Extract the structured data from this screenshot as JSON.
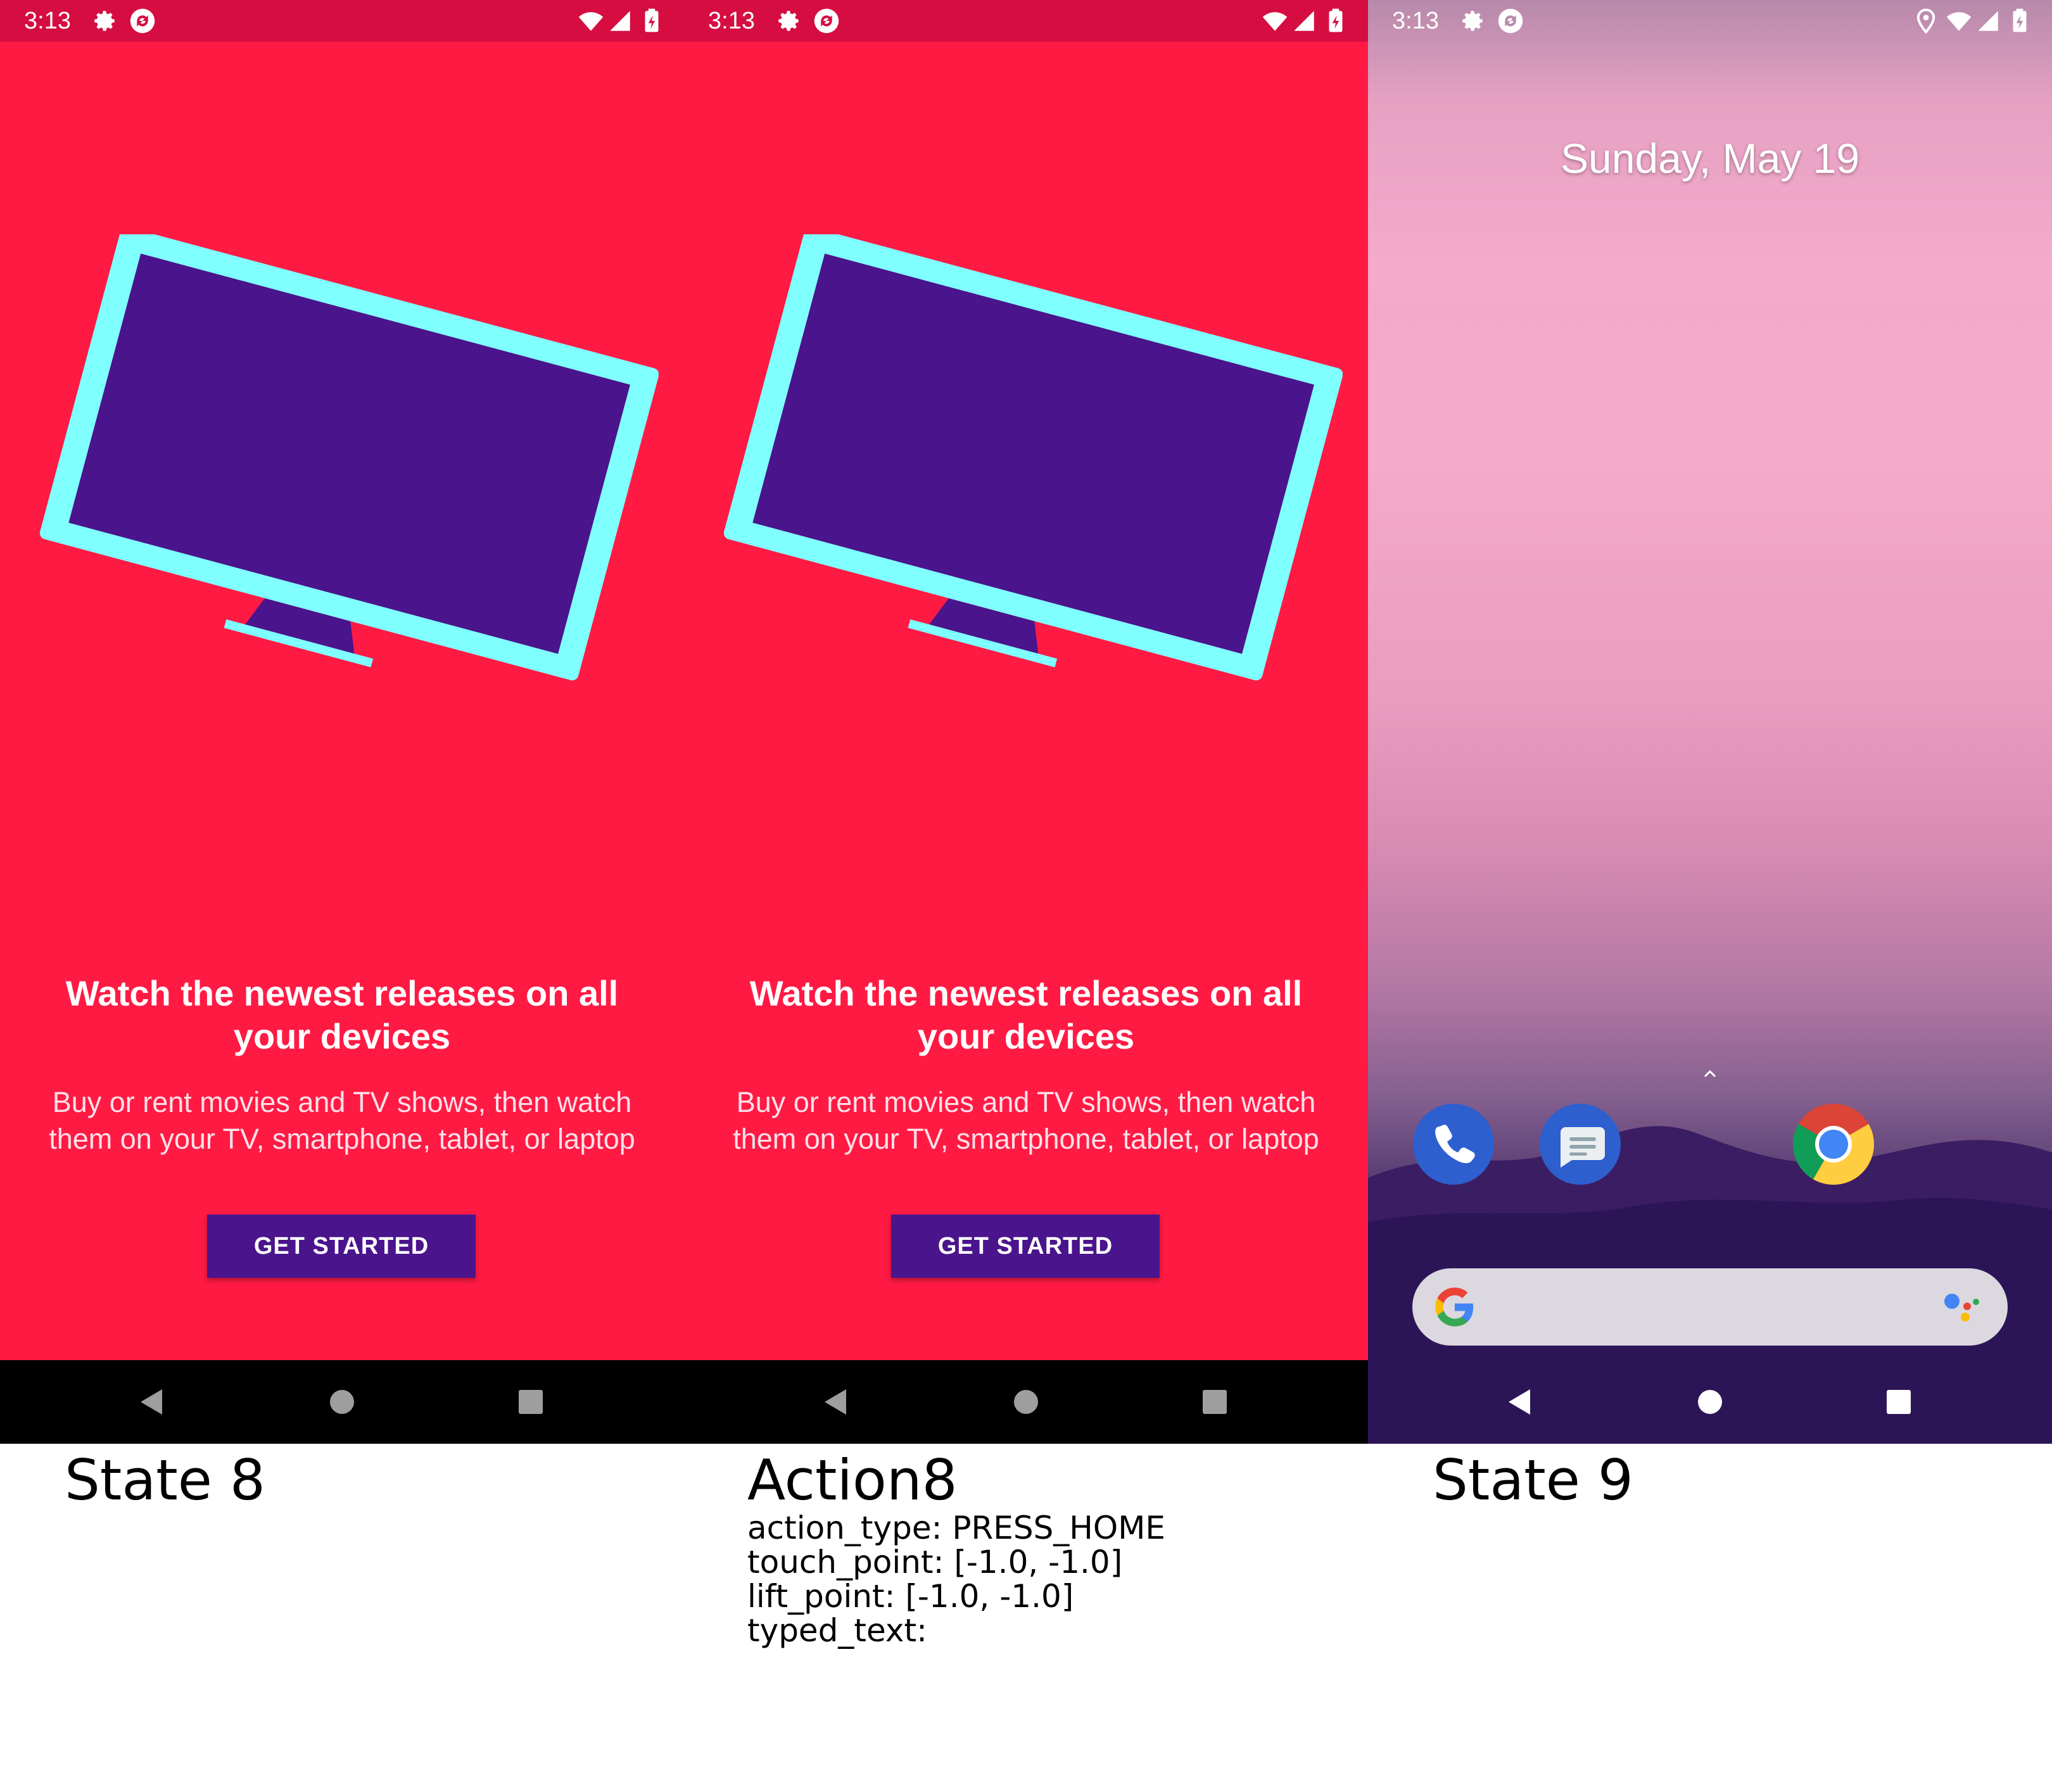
{
  "panels": [
    {
      "caption": "State 8",
      "status_time": "3:13",
      "title": "Watch the newest releases on all your devices",
      "body": "Buy or rent movies and TV shows, then watch them on your TV, smartphone, tablet, or laptop",
      "button_label": "GET STARTED"
    },
    {
      "caption": "Action8",
      "status_time": "3:13",
      "title": "Watch the newest releases on all your devices",
      "body": "Buy or rent movies and TV shows, then watch them on your TV, smartphone, tablet, or laptop",
      "button_label": "GET STARTED"
    },
    {
      "caption": "State 9",
      "status_time": "3:13",
      "date": "Sunday, May 19"
    }
  ],
  "action": {
    "action_type": "action_type: PRESS_HOME",
    "touch_point": "touch_point: [-1.0, -1.0]",
    "lift_point": "lift_point: [-1.0, -1.0]",
    "typed_text": "typed_text:"
  },
  "colors": {
    "app_background": "#ff1a44",
    "status_bar": "#d50d41",
    "tv_frame": "#80ffff",
    "tv_screen": "#4a148c",
    "button": "#4a148c"
  },
  "icons": {
    "status": [
      "settings-icon",
      "sync-icon",
      "wifi-icon",
      "signal-icon",
      "battery-icon",
      "location-icon"
    ],
    "dock": [
      "phone-icon",
      "messages-icon",
      "chrome-icon"
    ],
    "nav": [
      "back-icon",
      "home-icon",
      "recents-icon"
    ]
  }
}
